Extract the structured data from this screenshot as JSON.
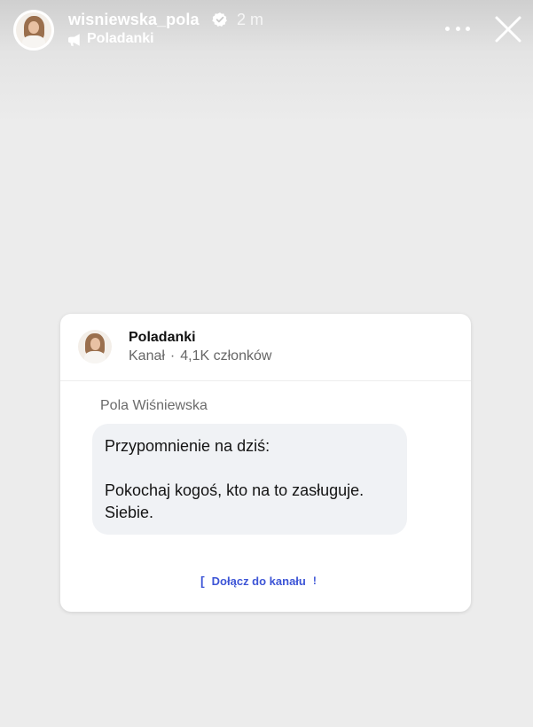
{
  "header": {
    "username": "wisniewska_pola",
    "time": "2 m",
    "channel_name": "Poladanki"
  },
  "card": {
    "title": "Poladanki",
    "subtitle_type": "Kanał",
    "subtitle_members": "4,1K członków",
    "sender": "Pola Wiśniewska",
    "message_line1": "Przypomnienie na dziś:",
    "message_line2": "Pokochaj kogoś, kto na to zasługuje.",
    "message_line3": "Siebie.",
    "join_label": "Dołącz do kanału"
  },
  "icons": {
    "verified": "verified-badge-icon",
    "channel": "channel-icon",
    "more": "more-options-icon",
    "close": "close-icon"
  }
}
